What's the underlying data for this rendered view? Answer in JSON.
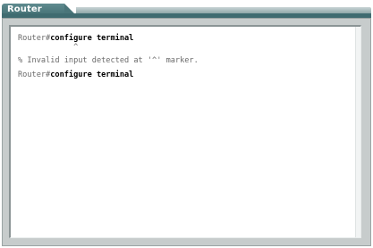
{
  "window": {
    "title": "Router"
  },
  "terminal": {
    "lines": [
      {
        "prompt": "Router#",
        "command": "configure terminal"
      },
      {
        "text": "            ^"
      },
      {
        "text": "% Invalid input detected at '^' marker."
      },
      {
        "prompt": "Router#",
        "command": "configure terminal"
      }
    ]
  }
}
